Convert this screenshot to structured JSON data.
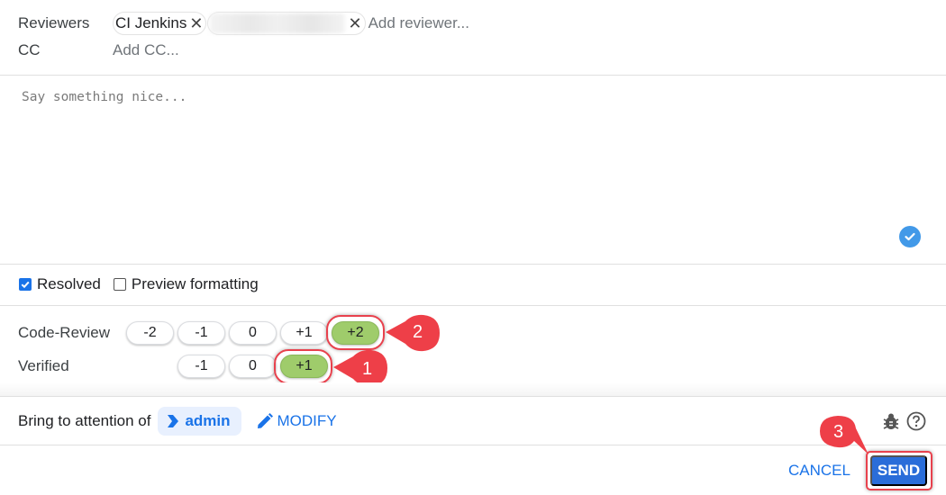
{
  "reviewers": {
    "label": "Reviewers",
    "chips": [
      {
        "name": "CI Jenkins",
        "remove": "✕"
      },
      {
        "name": "",
        "blurred": true,
        "remove": "✕"
      }
    ],
    "add_placeholder": "Add reviewer..."
  },
  "cc": {
    "label": "CC",
    "add_placeholder": "Add CC..."
  },
  "comment": {
    "placeholder": "Say something nice...",
    "value": ""
  },
  "options": {
    "resolved": {
      "label": "Resolved",
      "checked": true
    },
    "preview": {
      "label": "Preview formatting",
      "checked": false
    }
  },
  "labels": {
    "code_review": {
      "label": "Code-Review",
      "values": [
        "-2",
        "-1",
        "0",
        "+1",
        "+2"
      ],
      "selected": "+2"
    },
    "verified": {
      "label": "Verified",
      "values": [
        "-1",
        "0",
        "+1"
      ],
      "selected": "+1"
    }
  },
  "attention": {
    "label": "Bring to attention of",
    "user": "admin",
    "modify_label": "MODIFY"
  },
  "footer": {
    "cancel_label": "CANCEL",
    "send_label": "SEND"
  },
  "annotations": [
    {
      "number": "1",
      "target": "verified +1"
    },
    {
      "number": "2",
      "target": "code-review +2"
    },
    {
      "number": "3",
      "target": "send"
    }
  ],
  "colors": {
    "accent": "#1a73e8",
    "vote_selected": "#9fcc6b",
    "highlight": "#e8414d",
    "send_bg": "#2a6dd9"
  }
}
